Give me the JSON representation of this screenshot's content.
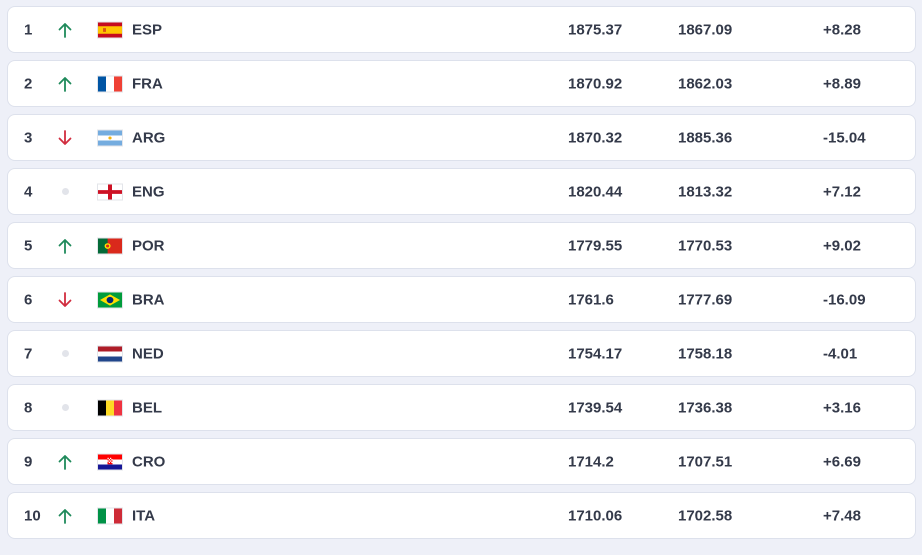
{
  "colors": {
    "up": "#1f8a5b",
    "down": "#d12d3f",
    "same": "#e2e4ea"
  },
  "rows": [
    {
      "rank": "1",
      "trend": "up",
      "flag": "spain-flag",
      "code": "ESP",
      "points": "1875.37",
      "previous": "1867.09",
      "change": "+8.28"
    },
    {
      "rank": "2",
      "trend": "up",
      "flag": "france-flag",
      "code": "FRA",
      "points": "1870.92",
      "previous": "1862.03",
      "change": "+8.89"
    },
    {
      "rank": "3",
      "trend": "down",
      "flag": "argentina-flag",
      "code": "ARG",
      "points": "1870.32",
      "previous": "1885.36",
      "change": "-15.04"
    },
    {
      "rank": "4",
      "trend": "same",
      "flag": "england-flag",
      "code": "ENG",
      "points": "1820.44",
      "previous": "1813.32",
      "change": "+7.12"
    },
    {
      "rank": "5",
      "trend": "up",
      "flag": "portugal-flag",
      "code": "POR",
      "points": "1779.55",
      "previous": "1770.53",
      "change": "+9.02"
    },
    {
      "rank": "6",
      "trend": "down",
      "flag": "brazil-flag",
      "code": "BRA",
      "points": "1761.6",
      "previous": "1777.69",
      "change": "-16.09"
    },
    {
      "rank": "7",
      "trend": "same",
      "flag": "netherlands-flag",
      "code": "NED",
      "points": "1754.17",
      "previous": "1758.18",
      "change": "-4.01"
    },
    {
      "rank": "8",
      "trend": "same",
      "flag": "belgium-flag",
      "code": "BEL",
      "points": "1739.54",
      "previous": "1736.38",
      "change": "+3.16"
    },
    {
      "rank": "9",
      "trend": "up",
      "flag": "croatia-flag",
      "code": "CRO",
      "points": "1714.2",
      "previous": "1707.51",
      "change": "+6.69"
    },
    {
      "rank": "10",
      "trend": "up",
      "flag": "italy-flag",
      "code": "ITA",
      "points": "1710.06",
      "previous": "1702.58",
      "change": "+7.48"
    }
  ]
}
